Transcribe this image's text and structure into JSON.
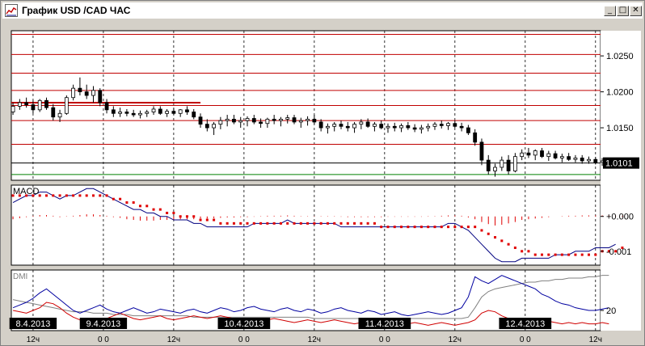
{
  "window": {
    "title": "График USD /CAD  ЧАС",
    "buttons": {
      "minimize": "_",
      "maximize": "□",
      "close": "✕"
    }
  },
  "chart_data": {
    "type": "candlestick",
    "symbol": "USD/CAD",
    "timeframe": "ЧАС",
    "price_panel": {
      "y_ticks": [
        "1.0250",
        "1.0200",
        "1.0150"
      ],
      "tick_values": [
        1.025,
        1.02,
        1.015
      ],
      "current_price_label": "1.0101",
      "current_price": 1.0101,
      "ylim": [
        1.0077,
        1.0285
      ],
      "horizontal_levels": [
        1.028,
        1.0252,
        1.0226,
        1.0202,
        1.0181,
        1.016,
        1.0127,
        1.0101
      ],
      "lower_line": 1.0085,
      "resistance_segment": {
        "value": 1.0185,
        "from_index": 0,
        "to_index": 28
      },
      "candles": [
        [
          1.0172,
          1.0185,
          1.0168,
          1.018
        ],
        [
          1.018,
          1.019,
          1.0175,
          1.0185
        ],
        [
          1.0185,
          1.0192,
          1.0178,
          1.0182
        ],
        [
          1.0182,
          1.0188,
          1.017,
          1.0175
        ],
        [
          1.0175,
          1.019,
          1.0172,
          1.0188
        ],
        [
          1.0188,
          1.0192,
          1.0175,
          1.0178
        ],
        [
          1.0178,
          1.0183,
          1.016,
          1.0165
        ],
        [
          1.0165,
          1.0175,
          1.0158,
          1.017
        ],
        [
          1.017,
          1.0195,
          1.0168,
          1.0192
        ],
        [
          1.0192,
          1.021,
          1.0188,
          1.0205
        ],
        [
          1.0205,
          1.022,
          1.0195,
          1.02
        ],
        [
          1.02,
          1.021,
          1.019,
          1.0195
        ],
        [
          1.0195,
          1.0208,
          1.0185,
          1.0202
        ],
        [
          1.0202,
          1.0205,
          1.018,
          1.0185
        ],
        [
          1.0185,
          1.019,
          1.017,
          1.0175
        ],
        [
          1.0175,
          1.018,
          1.0165,
          1.017
        ],
        [
          1.017,
          1.0178,
          1.0165,
          1.0172
        ],
        [
          1.0172,
          1.0176,
          1.0166,
          1.017
        ],
        [
          1.017,
          1.0175,
          1.0165,
          1.0168
        ],
        [
          1.0168,
          1.0174,
          1.0163,
          1.017
        ],
        [
          1.017,
          1.0175,
          1.0165,
          1.0172
        ],
        [
          1.0172,
          1.018,
          1.0168,
          1.0176
        ],
        [
          1.0176,
          1.018,
          1.0168,
          1.017
        ],
        [
          1.017,
          1.0176,
          1.0165,
          1.0173
        ],
        [
          1.0173,
          1.0178,
          1.0168,
          1.017
        ],
        [
          1.017,
          1.0176,
          1.0165,
          1.0175
        ],
        [
          1.0175,
          1.018,
          1.0168,
          1.0172
        ],
        [
          1.0172,
          1.0176,
          1.0162,
          1.0165
        ],
        [
          1.0165,
          1.017,
          1.015,
          1.0155
        ],
        [
          1.0155,
          1.0162,
          1.0145,
          1.015
        ],
        [
          1.015,
          1.0158,
          1.014,
          1.0155
        ],
        [
          1.0155,
          1.0165,
          1.0148,
          1.016
        ],
        [
          1.016,
          1.0168,
          1.0152,
          1.0162
        ],
        [
          1.0162,
          1.0168,
          1.0155,
          1.0158
        ],
        [
          1.0158,
          1.0165,
          1.015,
          1.016
        ],
        [
          1.016,
          1.0166,
          1.0152,
          1.0163
        ],
        [
          1.0163,
          1.0168,
          1.0155,
          1.0158
        ],
        [
          1.0158,
          1.0163,
          1.015,
          1.0156
        ],
        [
          1.0156,
          1.0164,
          1.015,
          1.0162
        ],
        [
          1.0162,
          1.0168,
          1.0155,
          1.016
        ],
        [
          1.016,
          1.0165,
          1.0152,
          1.0162
        ],
        [
          1.0162,
          1.0168,
          1.0156,
          1.0164
        ],
        [
          1.0164,
          1.0168,
          1.0155,
          1.0158
        ],
        [
          1.0158,
          1.0164,
          1.015,
          1.016
        ],
        [
          1.016,
          1.0166,
          1.0153,
          1.0162
        ],
        [
          1.0162,
          1.0168,
          1.0155,
          1.0158
        ],
        [
          1.0158,
          1.0162,
          1.0145,
          1.015
        ],
        [
          1.015,
          1.0156,
          1.0142,
          1.0152
        ],
        [
          1.0152,
          1.0158,
          1.0145,
          1.0155
        ],
        [
          1.0155,
          1.016,
          1.0148,
          1.0152
        ],
        [
          1.0152,
          1.0158,
          1.0145,
          1.015
        ],
        [
          1.015,
          1.0158,
          1.0143,
          1.0155
        ],
        [
          1.0155,
          1.0162,
          1.0148,
          1.0158
        ],
        [
          1.0158,
          1.0163,
          1.015,
          1.0152
        ],
        [
          1.0152,
          1.0158,
          1.0145,
          1.0155
        ],
        [
          1.0155,
          1.016,
          1.0148,
          1.015
        ],
        [
          1.015,
          1.0156,
          1.0143,
          1.0152
        ],
        [
          1.0152,
          1.0157,
          1.0145,
          1.015
        ],
        [
          1.015,
          1.0156,
          1.0144,
          1.0153
        ],
        [
          1.0153,
          1.0158,
          1.0147,
          1.015
        ],
        [
          1.015,
          1.0155,
          1.0144,
          1.0148
        ],
        [
          1.0148,
          1.0154,
          1.0142,
          1.015
        ],
        [
          1.015,
          1.0156,
          1.0145,
          1.0152
        ],
        [
          1.0152,
          1.0158,
          1.0147,
          1.0155
        ],
        [
          1.0155,
          1.016,
          1.0149,
          1.0153
        ],
        [
          1.0153,
          1.0158,
          1.0147,
          1.0156
        ],
        [
          1.0156,
          1.016,
          1.015,
          1.0152
        ],
        [
          1.0152,
          1.0157,
          1.0145,
          1.015
        ],
        [
          1.015,
          1.0154,
          1.014,
          1.0143
        ],
        [
          1.0143,
          1.0148,
          1.0125,
          1.013
        ],
        [
          1.013,
          1.0135,
          1.0098,
          1.0105
        ],
        [
          1.0105,
          1.0112,
          1.0085,
          1.009
        ],
        [
          1.009,
          1.01,
          1.0082,
          1.0095
        ],
        [
          1.0095,
          1.011,
          1.009,
          1.0105
        ],
        [
          1.0105,
          1.0112,
          1.0085,
          1.009
        ],
        [
          1.009,
          1.0115,
          1.0088,
          1.011
        ],
        [
          1.011,
          1.012,
          1.0105,
          1.0115
        ],
        [
          1.0115,
          1.0122,
          1.0108,
          1.0112
        ],
        [
          1.0112,
          1.012,
          1.0105,
          1.0118
        ],
        [
          1.0118,
          1.0122,
          1.0108,
          1.011
        ],
        [
          1.011,
          1.0118,
          1.0104,
          1.0114
        ],
        [
          1.0114,
          1.0118,
          1.0106,
          1.0108
        ],
        [
          1.0108,
          1.0114,
          1.0102,
          1.011
        ],
        [
          1.011,
          1.0115,
          1.0104,
          1.0106
        ],
        [
          1.0106,
          1.0112,
          1.0102,
          1.0108
        ],
        [
          1.0108,
          1.0112,
          1.01,
          1.0104
        ],
        [
          1.0104,
          1.011,
          1.01,
          1.0106
        ],
        [
          1.0106,
          1.0109,
          1.0099,
          1.0102
        ],
        [
          1.0102,
          1.0108,
          1.0097,
          1.0104
        ],
        [
          1.0104,
          1.0108,
          1.0098,
          1.01
        ],
        [
          1.01,
          1.0105,
          1.0095,
          1.0102
        ]
      ]
    },
    "macd_panel": {
      "title": "MACD",
      "y_ticks": [
        "+0.000",
        "-0.001"
      ],
      "tick_values": [
        0,
        -0.001
      ],
      "ylim": [
        -0.0014,
        0.0009
      ],
      "macd": [
        0.0004,
        0.0005,
        0.0006,
        0.0006,
        0.0007,
        0.0007,
        0.0006,
        0.0005,
        0.0006,
        0.0006,
        0.0007,
        0.0008,
        0.0008,
        0.0007,
        0.0006,
        0.0005,
        0.0004,
        0.0003,
        0.0002,
        0.0002,
        0.0001,
        0.0001,
        0.0,
        -0.0,
        -0.0001,
        -0.0001,
        -0.0001,
        -0.0002,
        -0.0002,
        -0.0003,
        -0.0003,
        -0.0003,
        -0.0003,
        -0.0003,
        -0.0003,
        -0.0003,
        -0.0002,
        -0.0002,
        -0.0002,
        -0.0002,
        -0.0002,
        -0.0001,
        -0.0002,
        -0.0002,
        -0.0002,
        -0.0002,
        -0.0002,
        -0.0002,
        -0.0002,
        -0.0003,
        -0.0003,
        -0.0003,
        -0.0003,
        -0.0003,
        -0.0003,
        -0.0003,
        -0.0003,
        -0.0003,
        -0.0003,
        -0.0003,
        -0.0003,
        -0.0003,
        -0.0003,
        -0.0003,
        -0.0003,
        -0.0002,
        -0.0002,
        -0.0003,
        -0.0004,
        -0.0006,
        -0.0008,
        -0.001,
        -0.0012,
        -0.0013,
        -0.0013,
        -0.0013,
        -0.0012,
        -0.0012,
        -0.0012,
        -0.0012,
        -0.0012,
        -0.0011,
        -0.0011,
        -0.0011,
        -0.001,
        -0.001,
        -0.001,
        -0.0009,
        -0.0009,
        -0.0009,
        -0.0008
      ],
      "signal": [
        0.0006,
        0.0006,
        0.0006,
        0.0006,
        0.0006,
        0.0006,
        0.0006,
        0.0006,
        0.0006,
        0.0006,
        0.0006,
        0.0006,
        0.0006,
        0.0006,
        0.0006,
        0.0005,
        0.0005,
        0.0004,
        0.0004,
        0.0003,
        0.0003,
        0.0002,
        0.0002,
        0.0001,
        0.0001,
        0.0,
        0.0,
        -0.0,
        -0.0001,
        -0.0001,
        -0.0001,
        -0.0002,
        -0.0002,
        -0.0002,
        -0.0002,
        -0.0002,
        -0.0002,
        -0.0002,
        -0.0002,
        -0.0002,
        -0.0002,
        -0.0002,
        -0.0002,
        -0.0002,
        -0.0002,
        -0.0002,
        -0.0002,
        -0.0002,
        -0.0002,
        -0.0002,
        -0.0002,
        -0.0002,
        -0.0002,
        -0.0002,
        -0.0002,
        -0.0003,
        -0.0003,
        -0.0003,
        -0.0003,
        -0.0003,
        -0.0003,
        -0.0003,
        -0.0003,
        -0.0003,
        -0.0003,
        -0.0003,
        -0.0003,
        -0.0003,
        -0.0003,
        -0.0003,
        -0.0004,
        -0.0005,
        -0.0006,
        -0.0007,
        -0.0008,
        -0.0009,
        -0.001,
        -0.001,
        -0.0011,
        -0.0011,
        -0.0011,
        -0.0011,
        -0.0011,
        -0.0011,
        -0.0011,
        -0.0011,
        -0.0011,
        -0.0011,
        -0.001,
        -0.001,
        -0.001,
        -0.0009
      ],
      "histogram": [
        -8e-05,
        -5e-05,
        -2e-05,
        2e-05,
        4e-05,
        4e-05,
        2e-05,
        -2e-05,
        1e-05,
        2e-05,
        4e-05,
        6e-05,
        6e-05,
        4e-05,
        2e-05,
        -2e-05,
        -4e-05,
        -8e-05,
        -0.0001,
        -0.00012,
        -0.00012,
        -0.00012,
        -0.0001,
        -0.0001,
        -0.0001,
        -8e-05,
        -8e-05,
        -8e-05,
        -6e-05,
        -6e-05,
        -5e-05,
        -4e-05,
        -3e-05,
        -3e-05,
        -2e-05,
        -2e-05,
        -1e-05,
        1e-05,
        2e-05,
        2e-05,
        2e-05,
        3e-05,
        2e-05,
        1e-05,
        1e-05,
        1e-05,
        1e-05,
        1e-05,
        1e-05,
        -1e-05,
        -2e-05,
        -2e-05,
        -2e-05,
        -2e-05,
        -2e-05,
        -2e-05,
        -1e-05,
        -1e-05,
        -1e-05,
        -1e-05,
        -1e-05,
        -1e-05,
        1e-05,
        1e-05,
        2e-05,
        3e-05,
        3e-05,
        2e-05,
        -3e-05,
        -8e-05,
        -0.00016,
        -0.00022,
        -0.00026,
        -0.00024,
        -0.0002,
        -0.00016,
        -0.0001,
        -8e-05,
        -6e-05,
        -4e-05,
        -2e-05,
        0.0,
        1e-05,
        2e-05,
        2e-05,
        3e-05,
        3e-05,
        3e-05,
        3e-05,
        3e-05,
        2e-05,
        2e-05
      ]
    },
    "dmi_panel": {
      "title": "DMI",
      "y_ticks": [
        "20"
      ],
      "tick_values": [
        20
      ],
      "ylim": [
        5,
        50
      ],
      "plus_di": [
        22,
        24,
        26,
        29,
        33,
        36,
        32,
        28,
        24,
        20,
        18,
        20,
        22,
        24,
        21,
        19,
        18,
        20,
        22,
        20,
        18,
        19,
        21,
        20,
        19,
        18,
        20,
        21,
        19,
        18,
        20,
        22,
        21,
        19,
        20,
        22,
        23,
        21,
        20,
        19,
        21,
        22,
        20,
        19,
        21,
        20,
        18,
        19,
        21,
        22,
        20,
        19,
        18,
        20,
        19,
        17,
        18,
        19,
        17,
        16,
        17,
        18,
        19,
        18,
        17,
        18,
        20,
        22,
        30,
        45,
        42,
        40,
        43,
        46,
        44,
        42,
        40,
        38,
        36,
        32,
        30,
        27,
        25,
        24,
        22,
        21,
        20,
        20,
        21,
        22
      ],
      "minus_di": [
        20,
        19,
        18,
        20,
        22,
        26,
        25,
        22,
        18,
        15,
        13,
        11,
        10,
        12,
        14,
        16,
        18,
        16,
        14,
        13,
        14,
        15,
        16,
        14,
        13,
        14,
        15,
        16,
        15,
        14,
        15,
        16,
        15,
        14,
        13,
        12,
        11,
        12,
        13,
        14,
        13,
        12,
        11,
        12,
        13,
        12,
        11,
        12,
        13,
        12,
        11,
        10,
        11,
        10,
        11,
        10,
        11,
        10,
        9,
        10,
        11,
        10,
        9,
        10,
        11,
        10,
        9,
        10,
        11,
        13,
        18,
        20,
        19,
        16,
        14,
        13,
        12,
        13,
        12,
        11,
        12,
        11,
        10,
        11,
        10,
        11,
        10,
        10,
        11,
        10
      ],
      "adx": [
        28,
        27,
        26,
        25,
        24,
        23,
        22,
        21,
        20,
        19,
        19,
        19,
        18,
        18,
        18,
        17,
        17,
        17,
        16,
        16,
        16,
        16,
        16,
        16,
        16,
        16,
        16,
        15,
        15,
        15,
        15,
        15,
        15,
        15,
        15,
        15,
        15,
        15,
        15,
        15,
        15,
        15,
        15,
        15,
        15,
        14,
        14,
        14,
        14,
        14,
        14,
        14,
        14,
        14,
        14,
        14,
        14,
        14,
        14,
        14,
        14,
        14,
        14,
        14,
        14,
        14,
        14,
        14,
        15,
        22,
        30,
        34,
        36,
        37,
        38,
        39,
        40,
        41,
        41,
        42,
        42,
        43,
        43,
        44,
        44,
        44,
        45,
        45,
        46,
        46
      ]
    },
    "time_axis": {
      "tick_labels": [
        "12ч",
        "0 0",
        "12ч",
        "0 0",
        "12ч",
        "0 0",
        "12ч",
        "0 0",
        "12ч"
      ],
      "tick_index": [
        6,
        27,
        48,
        69,
        90,
        111,
        132,
        153,
        174
      ],
      "date_labels": [
        {
          "text": "8.4.2013",
          "index": 6
        },
        {
          "text": "9.4.2013",
          "index": 27
        },
        {
          "text": "10.4.2013",
          "index": 69
        },
        {
          "text": "11.4.2013",
          "index": 111
        },
        {
          "text": "12.4.2013",
          "index": 153
        }
      ],
      "bar_hours_per_index": 2,
      "grid": true
    },
    "colors": {
      "background": "#ffffff",
      "candle": "#000000",
      "level_line": "#c00000",
      "lower_line": "#008000",
      "macd_signal": "#e00000",
      "macd_histogram": "#e00000",
      "macd_line": "#000080",
      "plus_di": "#0000a0",
      "minus_di": "#d00000",
      "adx": "#808080",
      "date_label_bg": "#000000",
      "price_label_bg": "#000000"
    }
  }
}
